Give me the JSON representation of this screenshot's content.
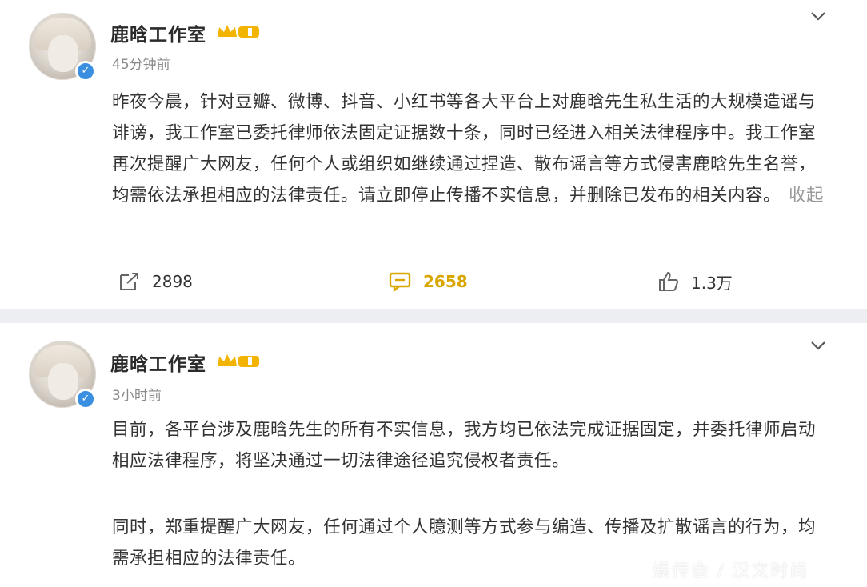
{
  "post1": {
    "username": "鹿晗工作室",
    "time": "45分钟前",
    "text": "昨夜今晨，针对豆瓣、微博、抖音、小红书等各大平台上对鹿晗先生私生活的大规模造谣与诽谤，我工作室已委托律师依法固定证据数十条，同时已经进入相关法律程序中。我工作室再次提醒广大网友，任何个人或组织如继续通过捏造、散布谣言等方式侵害鹿晗先生名誉，均需依法承担相应的法律责任。请立即停止传播不实信息，并删除已发布的相关内容。",
    "collapse": "收起",
    "actions": {
      "repost_count": "2898",
      "comment_count": "2658",
      "like_count": "1.3万"
    }
  },
  "post2": {
    "username": "鹿晗工作室",
    "time": "3小时前",
    "paragraph1": "目前，各平台涉及鹿晗先生的所有不实信息，我方均已依法完成证据固定，并委托律师启动相应法律程序，将坚决通过一切法律途径追究侵权者责任。",
    "paragraph2": "同时，郑重提醒广大网友，任何通过个人臆测等方式参与编造、传播及扩散谣言的行为，均需承担相应的法律责任。"
  },
  "watermark": "娱传会 / 汉文时尚",
  "colors": {
    "accent_comment": "#d9a600",
    "verified_badge": "#3a8fe0",
    "crown_gold": "#f2b400"
  },
  "icons": [
    "verified-badge-icon",
    "crown-vip-icon",
    "chevron-down-icon",
    "repost-icon",
    "comment-icon",
    "like-icon"
  ]
}
